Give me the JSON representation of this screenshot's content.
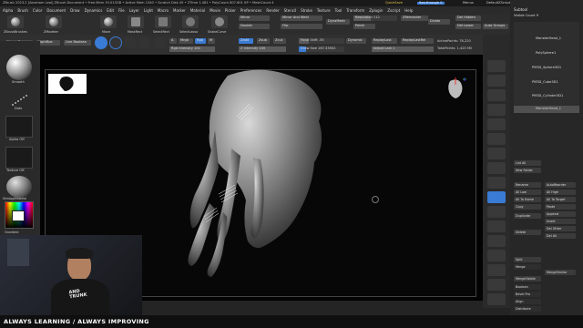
{
  "titlebar": {
    "text": "ZBrush 2023.2 [Abraham Leal]   ZBrush Document   • Free Mem 19.013GB • Active Mem 1340 • Scratch Disk 45 • ZTime 1.461 • PolyCount 807.601 KP • MeshCount 4",
    "quicksave": "QuickSave",
    "seethrough": "See-through 0",
    "menus": "Menus",
    "defaultscript": "DefaultZScript"
  },
  "menubar": [
    "Alpha",
    "Brush",
    "Color",
    "Document",
    "Draw",
    "Dynamics",
    "Edit",
    "File",
    "Layer",
    "Light",
    "Macro",
    "Marker",
    "Material",
    "Movie",
    "Picker",
    "Preferences",
    "Render",
    "Stencil",
    "Stroke",
    "Texture",
    "Tool",
    "Transform",
    "Zplugin",
    "Zscript",
    "Help"
  ],
  "toolrow": {
    "tools": [
      "ZBrushBrushes",
      "ZModeler",
      "Move",
      "MaskRect",
      "SelectRect",
      "SelectLasso",
      "SnakeCurve",
      "ZModeler"
    ],
    "mirror_label": "Mirror",
    "mirror_weld_label": "Mirror And Weld",
    "double_label": "Double",
    "flip_label": "Flip",
    "dynamesh_label": "DynaMesh",
    "resolution_label": "Resolution 112",
    "polish_label": "Polish",
    "zremesher_label": "ZRemesher",
    "divide_label": "Divide",
    "del_hidden_label": "Del Hidden",
    "del_lower_label": "Del Lower",
    "auto_groups_label": "Auto Groups"
  },
  "ctrlrow": {
    "a_label": "A",
    "mrgb_label": "Mrgb",
    "rgb_label": "Rgb",
    "m_label": "M",
    "zadd_label": "Zadd",
    "zsub_label": "Zsub",
    "zcut_label": "Zcut",
    "rgb_intensity": "Rgb Intensity 100",
    "z_intensity": "Z Intensity 100",
    "focal_shift": "Focal Shift -55",
    "draw_size": "Draw Size 167.33502",
    "dynamic_label": "Dynamic",
    "replay_last": "ReplayLast",
    "replay_last_rel": "ReplayLastRel",
    "adjust_last": "Adjust Last 1",
    "active_points": "ActivePoints: 78,220",
    "total_points": "TotalPoints: 1.420 Mil"
  },
  "tabs": {
    "home": "Home Page",
    "lightbox": "LightBox",
    "live_boolean": "Live Boolean"
  },
  "leftpanel": {
    "brush_name": "Smooth",
    "stroke_name": "Dots",
    "alpha_name": "Alpha Off",
    "texture_name": "Texture Off",
    "material_name": "SkinAppMaterial",
    "gradient_label": "Gradient",
    "switch_color": "SwitchColor",
    "alternate": "Alternate"
  },
  "rightpanel": {
    "buttons": [
      "BPR",
      "SPix 3",
      "Scroll",
      "Zoom",
      "Actual",
      "AAHalf",
      "Persp",
      "Floor",
      "Local",
      "Gyro",
      "Frame",
      "Move",
      "Zoom3D",
      "Rotate",
      "Transp",
      "Ghost",
      "Solo",
      "Xpose"
    ]
  },
  "subtool": {
    "header": "Subtool",
    "visible_count": "Visible Count 9",
    "items": [
      "MonsterHead_1",
      "PolySphere1",
      "PM3D_Sphere3D1",
      "PM3D_Cube3D1",
      "PM3D_Cylinder3D1",
      "MonsterHead_1"
    ],
    "list_all": "List All",
    "new_folder": "New Folder",
    "rename": "Rename",
    "auto_reorder": "AutoReorder",
    "all_low": "All Low",
    "all_high": "All High",
    "all_to_home": "All To Home",
    "all_to_target": "All To Target",
    "copy": "Copy",
    "paste": "Paste",
    "duplicate": "Duplicate",
    "append": "Append",
    "insert": "Insert",
    "delete": "Delete",
    "del_other": "Del Other",
    "del_all": "Del All",
    "split": "Split",
    "merge": "Merge",
    "merge_similar": "MergeSimilar",
    "merge_visible": "MergeVisible",
    "boolean": "Boolean",
    "bevel_pro": "Bevel Pro",
    "align": "Align",
    "distribute": "Distribute",
    "remesh": "Remesh"
  },
  "webcam": {
    "shirt_text": "AND\nTRUNK"
  },
  "banner": "ALWAYS LEARNING  / ALWAYS IMPROVING",
  "colors": {
    "accent": "#3a7bd5",
    "viewport_bg": "#030303",
    "panel_bg": "#2a2a2a"
  }
}
